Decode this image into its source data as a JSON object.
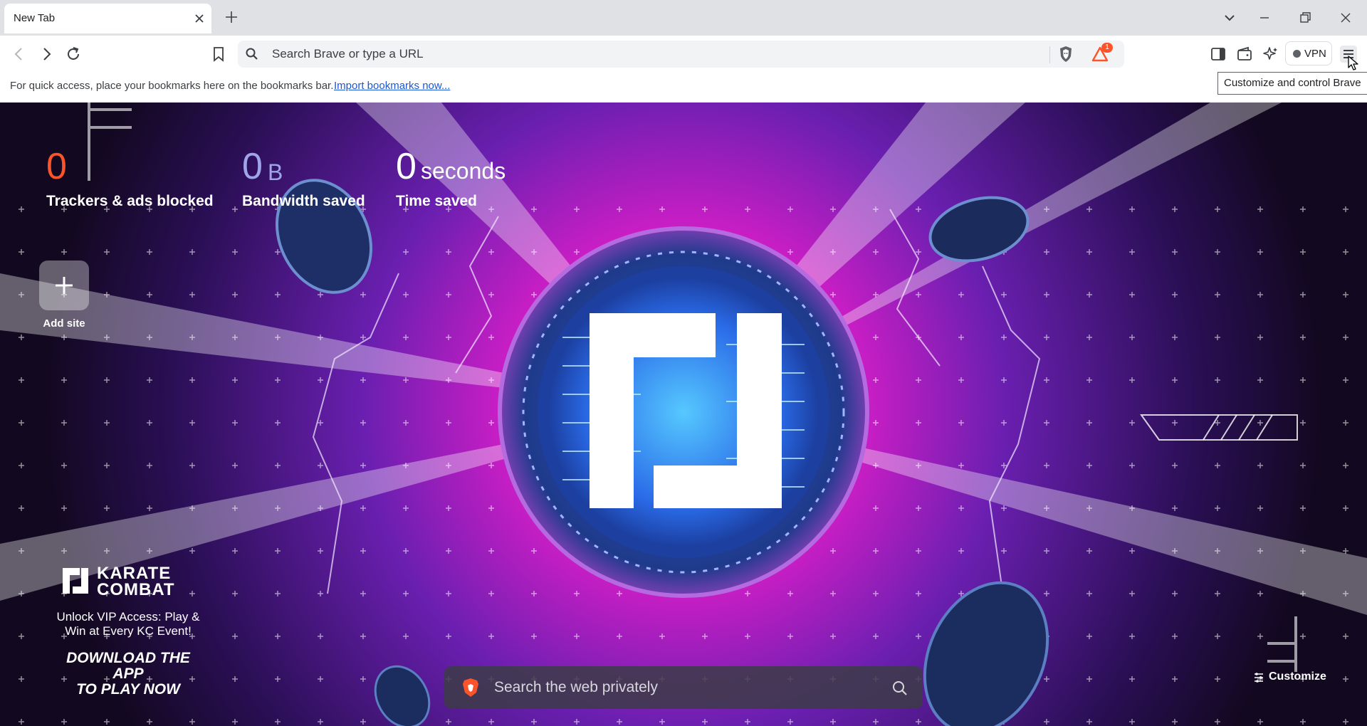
{
  "tab": {
    "title": "New Tab"
  },
  "omnibox": {
    "placeholder": "Search Brave or type a URL"
  },
  "rewards": {
    "badge": "1"
  },
  "vpn": {
    "label": "VPN"
  },
  "bookmarks_bar": {
    "hint": "For quick access, place your bookmarks here on the bookmarks bar.",
    "import_link": "Import bookmarks now..."
  },
  "tooltip": {
    "text": "Customize and control Brave"
  },
  "stats": {
    "trackers": {
      "value": "0",
      "label": "Trackers & ads blocked"
    },
    "bandwidth": {
      "value": "0",
      "unit": "B",
      "label": "Bandwidth saved"
    },
    "time": {
      "value": "0",
      "unit": "seconds",
      "label": "Time saved"
    }
  },
  "add_site": {
    "label": "Add site"
  },
  "sponsor": {
    "brand_line1": "KARATE",
    "brand_line2": "COMBAT",
    "tagline_line1": "Unlock VIP Access: Play &",
    "tagline_line2": "Win at Every KC Event!",
    "cta_line1": "DOWNLOAD THE APP",
    "cta_line2": "TO PLAY NOW"
  },
  "ntp_search": {
    "placeholder": "Search the web privately"
  },
  "customize": {
    "label": "Customize"
  },
  "colors": {
    "trackers_accent": "#fb542b",
    "bandwidth_accent": "#a0a5eb",
    "brave_orange": "#fb542b"
  }
}
